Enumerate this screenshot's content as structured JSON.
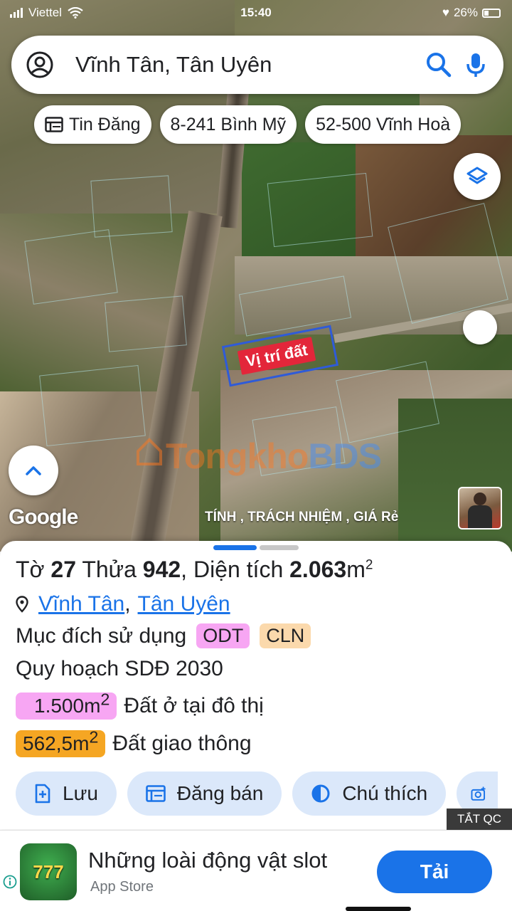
{
  "status_bar": {
    "carrier": "Viettel",
    "time": "15:40",
    "battery": "26%"
  },
  "search": {
    "query": "Vĩnh Tân, Tân Uyên"
  },
  "chips": [
    {
      "label": "Tin Đăng",
      "icon": "listing-icon"
    },
    {
      "label": "8-241 Bình Mỹ"
    },
    {
      "label": "52-500 Vĩnh Hoà"
    }
  ],
  "map": {
    "land_label": "Vị trí đất",
    "watermark_a": "Tongkho",
    "watermark_b": "BDS",
    "google_logo": "Google",
    "caption": "TÍNH , TRÁCH NHIỆM , GIÁ Rẻ"
  },
  "sheet": {
    "sheet_label": "Tờ",
    "sheet_no": "27",
    "lot_label": "Thửa",
    "lot_no": "942",
    "area_label": "Diện tích",
    "area_value": "2.063",
    "area_unit": "m",
    "area_sup": "2",
    "location_a": "Vĩnh Tân",
    "location_b": "Tân Uyên",
    "purpose_label": "Mục đích sử dụng",
    "tag_odt": "ODT",
    "tag_cln": "CLN",
    "plan_label": "Quy hoạch SDĐ 2030",
    "zones": [
      {
        "value": "1.500m",
        "sup": "2",
        "desc": "Đất ở tại đô thị",
        "color": "#f7a6f3"
      },
      {
        "value": "562,5m",
        "sup": "2",
        "desc": "Đất giao thông",
        "color": "#f5a623"
      }
    ],
    "actions": [
      {
        "label": "Lưu",
        "icon": "bookmark-add-icon"
      },
      {
        "label": "Đăng bán",
        "icon": "listing-icon"
      },
      {
        "label": "Chú thích",
        "icon": "legend-icon"
      },
      {
        "label": "",
        "icon": "camera-add-icon"
      }
    ]
  },
  "ad": {
    "close_label": "TẮT QC",
    "app_icon_text": "777",
    "title": "Những loài động vật slot",
    "source": "App Store",
    "cta": "Tải"
  },
  "colors": {
    "accent": "#1a73e8",
    "land_label": "#e3263a",
    "outline": "#2f5bd8"
  }
}
